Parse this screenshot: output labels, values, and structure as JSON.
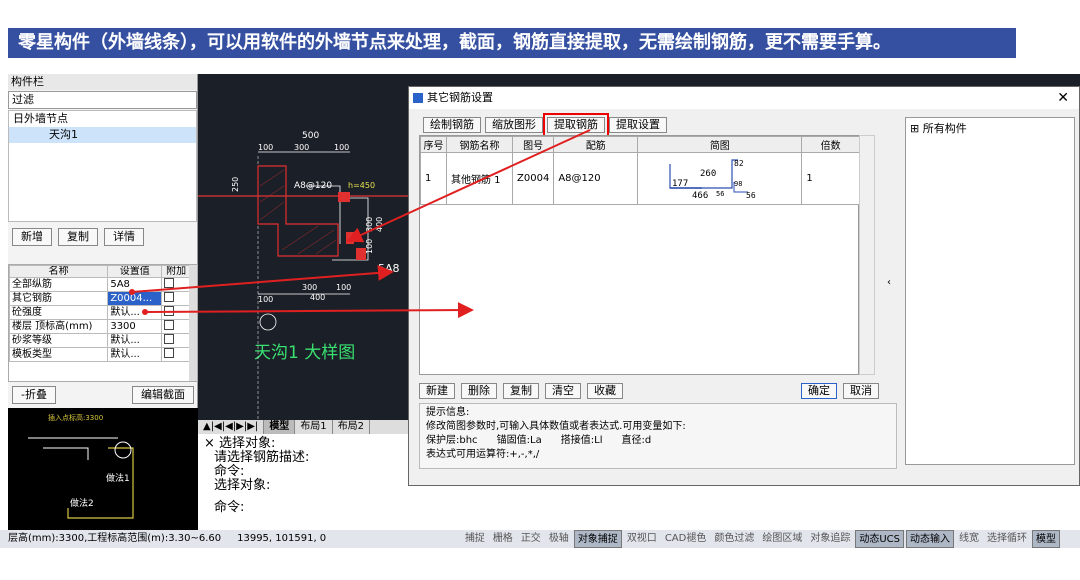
{
  "banner": {
    "title": "零星构件（外墙线条），可以用软件的外墙节点来处理，截面，钢筋直接提取，无需绘制钢筋，更不需要手算。"
  },
  "left": {
    "panel_title": "构件栏",
    "filter": "过滤",
    "tree_parent": "日外墙节点",
    "tree_child": "天沟1",
    "btn_new": "新增",
    "btn_copy": "复制",
    "btn_detail": "详情",
    "prop_headers": [
      "名称",
      "设置值",
      "附加"
    ],
    "props": [
      {
        "name": "全部纵筋",
        "value": "5A8"
      },
      {
        "name": "其它钢筋",
        "value": "Z0004..."
      },
      {
        "name": "砼强度",
        "value": "默认..."
      },
      {
        "name": "楼层 顶标高(mm)",
        "value": "3300"
      },
      {
        "name": "砂浆等级",
        "value": "默认..."
      },
      {
        "name": "模板类型",
        "value": "默认..."
      }
    ],
    "fold": "-折叠",
    "edit_section": "编辑截面",
    "preview_label": "插入点标高:3300",
    "preview_method1": "做法1",
    "preview_method2": "做法2"
  },
  "cad": {
    "dim_500": "500",
    "dim_100a": "100",
    "dim_300": "300",
    "dim_100b": "100",
    "bar_a8": "A8@120",
    "h_label": "h=450",
    "dim_250": "250",
    "dim_300v": "300",
    "dim_400v": "400",
    "dim_100v": "100",
    "bar_5a8": "5A8",
    "dim_100c": "100",
    "dim_300b": "300",
    "dim_100d": "100",
    "dim_400": "400",
    "caption": "天沟1 大样图"
  },
  "cad_tabs": [
    "模型",
    "布局1",
    "布局2"
  ],
  "cmd_lines": [
    "× 选择对象:",
    "请选择钢筋描述:",
    "命令:",
    "选择对象:",
    "命令:"
  ],
  "dialog": {
    "title": "其它钢筋设置",
    "toolbar": [
      "绘制钢筋",
      "缩放图形",
      "提取钢筋",
      "提取设置"
    ],
    "headers": [
      "序号",
      "钢筋名称",
      "图号",
      "配筋",
      "简图",
      "倍数"
    ],
    "row": {
      "index": "1",
      "name": "其他钢筋 1",
      "code": "Z0004",
      "rebar": "A8@120",
      "multiplier": "1"
    },
    "sketch": {
      "v260": "260",
      "v82": "82",
      "v177": "177",
      "v466": "466",
      "v56a": "56",
      "v56b": "56",
      "v98": "98"
    },
    "bottom_buttons": [
      "新建",
      "删除",
      "复制",
      "清空",
      "收藏"
    ],
    "ok": "确定",
    "cancel": "取消",
    "hint_title": "提示信息:",
    "hint_1": "修改简图参数时,可输入具体数值或者表达式.可用变量如下:",
    "hint_2": "保护层:bhc      锚固值:La      搭接值:Ll      直径:d",
    "hint_3": "表达式可用运算符:+,-,*,/",
    "right_tree": "⊞ 所有构件"
  },
  "status": {
    "floor": "层高(mm):3300,工程标高范围(m):3.30~6.60",
    "coord": "13995, 101591, 0",
    "snaps": [
      {
        "label": "捕捉",
        "on": false
      },
      {
        "label": "栅格",
        "on": false
      },
      {
        "label": "正交",
        "on": false
      },
      {
        "label": "极轴",
        "on": false
      },
      {
        "label": "对象捕捉",
        "on": true
      },
      {
        "label": "双视口",
        "on": false
      },
      {
        "label": "CAD褪色",
        "on": false
      },
      {
        "label": "颜色过滤",
        "on": false
      },
      {
        "label": "绘图区域",
        "on": false
      },
      {
        "label": "对象追踪",
        "on": false
      },
      {
        "label": "动态UCS",
        "on": true
      },
      {
        "label": "动态输入",
        "on": true
      },
      {
        "label": "线宽",
        "on": false
      },
      {
        "label": "选择循环",
        "on": false
      },
      {
        "label": "模型",
        "on": true
      }
    ]
  }
}
